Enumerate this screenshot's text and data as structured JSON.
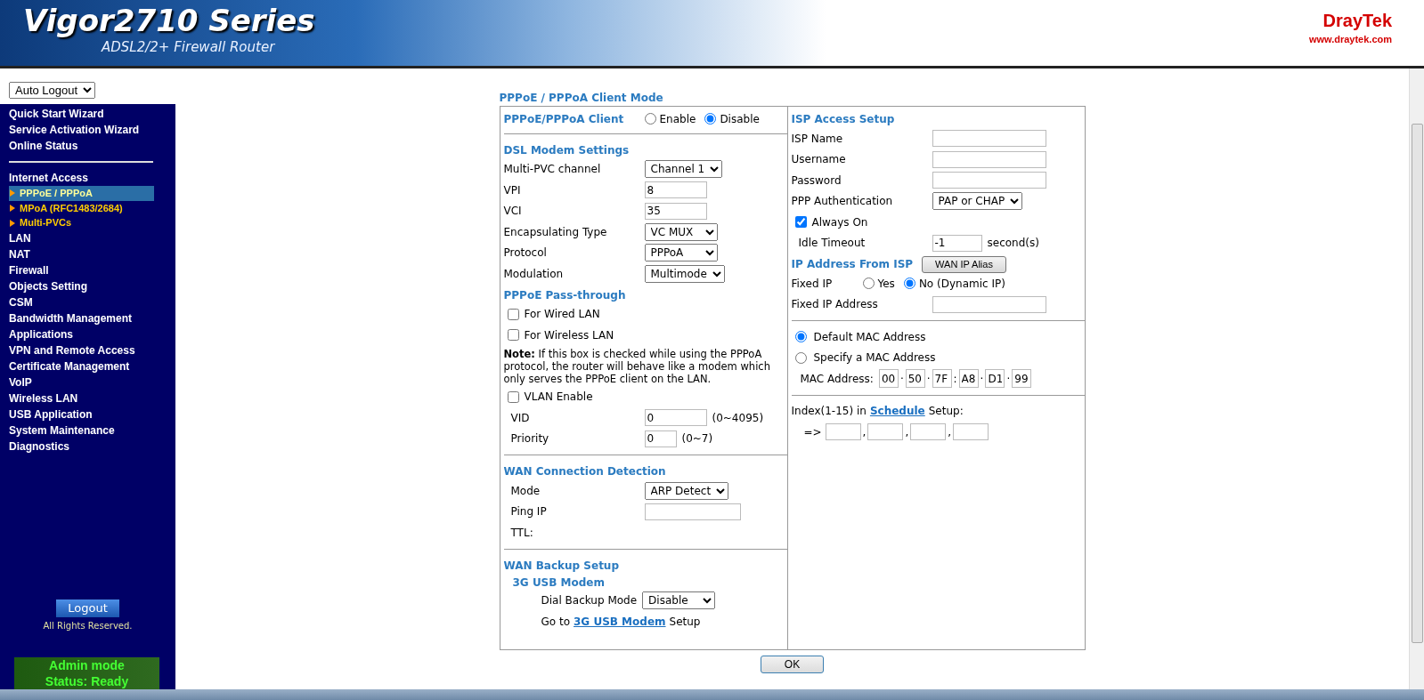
{
  "header": {
    "title": "Vigor2710 Series",
    "subtitle": "ADSL2/2+ Firewall Router",
    "brand": "DrayTek",
    "website": "www.draytek.com"
  },
  "sidebar": {
    "auto_logout": "Auto Logout",
    "top_items": [
      {
        "label": "Quick Start Wizard"
      },
      {
        "label": "Service Activation Wizard"
      },
      {
        "label": "Online Status"
      }
    ],
    "items": [
      {
        "label": "Internet Access",
        "children": [
          {
            "label": "PPPoE / PPPoA",
            "selected": true
          },
          {
            "label": "MPoA (RFC1483/2684)",
            "selected": false
          },
          {
            "label": "Multi-PVCs",
            "selected": false
          }
        ]
      },
      {
        "label": "LAN"
      },
      {
        "label": "NAT"
      },
      {
        "label": "Firewall"
      },
      {
        "label": "Objects Setting"
      },
      {
        "label": "CSM"
      },
      {
        "label": "Bandwidth Management"
      },
      {
        "label": "Applications"
      },
      {
        "label": "VPN and Remote Access"
      },
      {
        "label": "Certificate Management"
      },
      {
        "label": "VoIP"
      },
      {
        "label": "Wireless LAN"
      },
      {
        "label": "USB Application"
      },
      {
        "label": "System Maintenance"
      },
      {
        "label": "Diagnostics"
      }
    ],
    "logout": "Logout",
    "copyright": "All Rights Reserved.",
    "status_lines": [
      "Admin mode",
      "Status: Ready"
    ]
  },
  "main": {
    "title": "PPPoE / PPPoA Client Mode",
    "left_sections": [
      {
        "rows": [
          {
            "kind": "radio_heading",
            "label": "PPPoE/PPPoA Client",
            "options": [
              {
                "label": "Enable",
                "selected": false
              },
              {
                "label": "Disable",
                "selected": true
              }
            ]
          }
        ]
      },
      {
        "rows": [
          {
            "kind": "heading",
            "text": "DSL Modem Settings"
          },
          {
            "kind": "select",
            "label": "Multi-PVC channel",
            "value": "Channel 1"
          },
          {
            "kind": "text",
            "label": "VPI",
            "value": "8"
          },
          {
            "kind": "text",
            "label": "VCI",
            "value": "35"
          },
          {
            "kind": "select",
            "label": "Encapsulating Type",
            "value": "VC MUX"
          },
          {
            "kind": "select",
            "label": "Protocol",
            "value": "PPPoA"
          },
          {
            "kind": "select",
            "label": "Modulation",
            "value": "Multimode"
          },
          {
            "kind": "heading",
            "text": "PPPoE Pass-through"
          },
          {
            "kind": "checkbox",
            "label": "For Wired LAN",
            "checked": false
          },
          {
            "kind": "checkbox",
            "label": "For Wireless LAN",
            "checked": false
          },
          {
            "kind": "note",
            "text": "**Note:** If this box is checked while using the PPPoA protocol, the router will behave like a modem which only serves the PPPoE client on the LAN."
          },
          {
            "kind": "checkbox",
            "label": "VLAN Enable",
            "checked": false
          },
          {
            "kind": "text",
            "label": "VID",
            "value": "0",
            "suffix": "(0~4095)",
            "indented": true
          },
          {
            "kind": "text",
            "label": "Priority",
            "value": "0",
            "suffix": "(0~7)",
            "indented": true
          }
        ]
      },
      {
        "rows": [
          {
            "kind": "heading",
            "text": "WAN Connection Detection"
          },
          {
            "kind": "select",
            "label": "Mode",
            "value": "ARP Detect",
            "indented": true
          },
          {
            "kind": "text",
            "label": "Ping IP",
            "indented": true
          },
          {
            "kind": "plain",
            "label": "TTL:",
            "indented": true
          }
        ]
      },
      {
        "rows": [
          {
            "kind": "heading",
            "text": "WAN Backup Setup"
          },
          {
            "kind": "group",
            "title": "3G USB Modem",
            "children": [
              {
                "kind": "select",
                "label": "Dial Backup Mode",
                "value": "Disable"
              },
              {
                "kind": "link_line",
                "before": "Go to",
                "link": "3G USB Modem",
                "after": "Setup"
              }
            ]
          }
        ]
      }
    ],
    "right_sections": [
      {
        "rows": [
          {
            "kind": "heading",
            "text": "ISP Access Setup"
          },
          {
            "kind": "text",
            "label": "ISP Name"
          },
          {
            "kind": "text",
            "label": "Username"
          },
          {
            "kind": "text",
            "label": "Password"
          },
          {
            "kind": "select",
            "label": "PPP Authentication",
            "value": "PAP or CHAP"
          },
          {
            "kind": "checkbox",
            "label": "Always On",
            "checked": true
          },
          {
            "kind": "text",
            "label": "Idle Timeout",
            "value": "-1",
            "suffix": "second(s)",
            "indented": true
          },
          {
            "kind": "heading",
            "text": "IP Address From ISP",
            "button": "WAN IP Alias"
          },
          {
            "kind": "radio_group",
            "label": "Fixed IP",
            "options": [
              {
                "label": "Yes",
                "selected": false
              },
              {
                "label": "No (Dynamic IP)",
                "selected": true
              }
            ]
          },
          {
            "kind": "text",
            "label": "Fixed IP Address"
          }
        ]
      },
      {
        "rows": [
          {
            "kind": "radio_option",
            "label": "Default MAC Address",
            "selected": true
          },
          {
            "kind": "radio_option",
            "label": "Specify a MAC Address",
            "selected": false
          },
          {
            "kind": "mac",
            "label": "MAC Address:",
            "parts": [
              {
                "value": "00"
              },
              {
                "sep": "·",
                "value": "50"
              },
              {
                "sep": "·",
                "value": "7F"
              },
              {
                "sep": ":",
                "value": "A8"
              },
              {
                "sep": "·",
                "value": "D1"
              },
              {
                "sep": "·",
                "value": "99"
              }
            ]
          }
        ]
      },
      {
        "rows": [
          {
            "kind": "schedule",
            "before": "Index(1-15) in",
            "link": "Schedule",
            "after": "Setup:",
            "arrow": "=>",
            "separators": [
              ",",
              ",",
              ","
            ]
          }
        ]
      }
    ],
    "ok_button": "OK"
  }
}
